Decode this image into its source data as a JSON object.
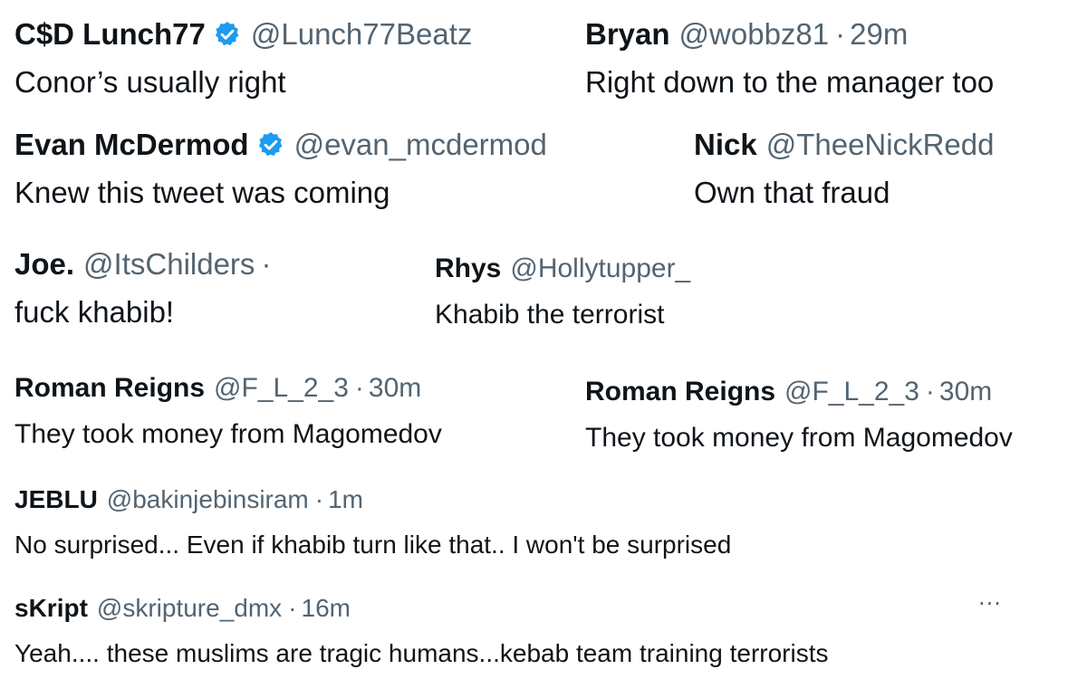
{
  "badge_color": "#1d9bf0",
  "more_label": "···",
  "tweets": [
    {
      "name": "C$D Lunch77",
      "verified": true,
      "handle": "@Lunch77Beatz",
      "time": "",
      "text": "Conor’s usually right"
    },
    {
      "name": "Bryan",
      "verified": false,
      "handle": "@wobbz81",
      "time": "29m",
      "text": "Right down to the manager too"
    },
    {
      "name": "Evan McDermod",
      "verified": true,
      "handle": "@evan_mcdermod",
      "time": "",
      "text": "Knew this tweet was coming"
    },
    {
      "name": "Nick",
      "verified": false,
      "handle": "@TheeNickRedd",
      "time": "",
      "text": "Own that fraud"
    },
    {
      "name": "Joe.",
      "verified": false,
      "handle": "@ItsChilders",
      "time": "",
      "sep": "·",
      "text": "fuck khabib!"
    },
    {
      "name": "Rhys",
      "verified": false,
      "handle": "@Hollytupper_",
      "time": "",
      "text": "Khabib the terrorist"
    },
    {
      "name": "Roman Reigns",
      "verified": false,
      "handle": "@F_L_2_3",
      "time": "30m",
      "text": "They took money from Magomedov"
    },
    {
      "name": "Roman Reigns",
      "verified": false,
      "handle": "@F_L_2_3",
      "time": "30m",
      "text": "They took money from Magomedov"
    },
    {
      "name": "JEBLU",
      "verified": false,
      "handle": "@bakinjebinsiram",
      "time": "1m",
      "text": "No surprised... Even if khabib turn like that.. I won't be surprised"
    },
    {
      "name": "sKript",
      "verified": false,
      "handle": "@skripture_dmx",
      "time": "16m",
      "text": "Yeah.... these muslims are tragic humans...kebab team training terrorists"
    }
  ]
}
